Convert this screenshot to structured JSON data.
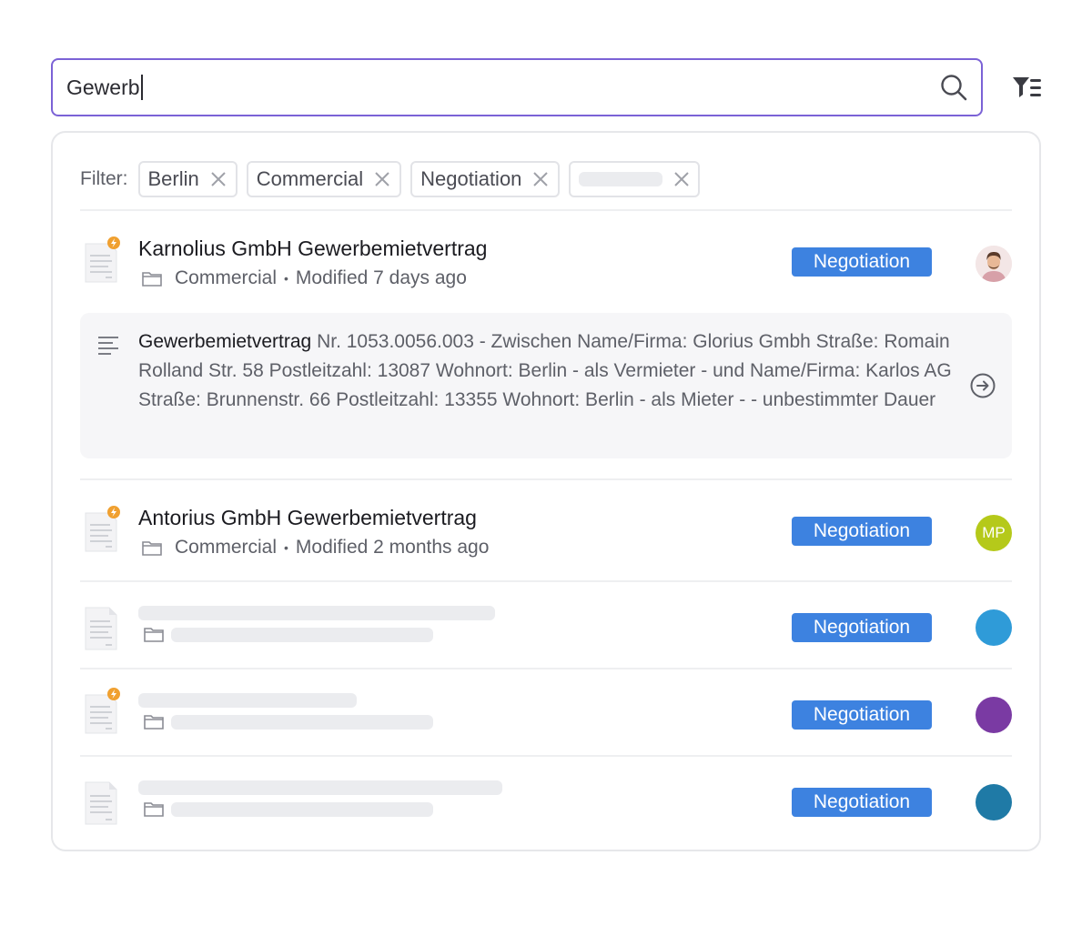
{
  "search": {
    "value": "Gewerb"
  },
  "filters": {
    "label": "Filter:",
    "chips": [
      "Berlin",
      "Commercial",
      "Negotiation"
    ]
  },
  "results": [
    {
      "title": "Karnolius GmbH Gewerbemietvertrag",
      "category": "Commercial",
      "separator": "•",
      "modified": "Modified 7 days ago",
      "status": "Negotiation",
      "avatar": "",
      "flagged": true
    },
    {
      "title": "Antorius GmbH Gewerbemietvertrag",
      "category": "Commercial",
      "separator": "•",
      "modified": "Modified 2 months ago",
      "status": "Negotiation",
      "avatar": "MP",
      "flagged": true
    },
    {
      "status": "Negotiation",
      "flagged": false
    },
    {
      "status": "Negotiation",
      "flagged": true
    },
    {
      "status": "Negotiation",
      "flagged": false
    }
  ],
  "snippet": {
    "highlight": "Gewerbemietvertrag",
    "text": " Nr. 1053.0056.003 - Zwischen Name/Firma: Glorius Gmbh Straße: Romain Rolland Str. 58 Postleitzahl: 13087 Wohnort: Berlin - als Vermieter - und Name/Firma: Karlos AG Straße: Brunnenstr. 66 Postleitzahl: 13355 Wohnort: Berlin - als Mieter - - unbestimmter Dauer"
  },
  "colors": {
    "accent": "#7b62d6",
    "status_badge": "#3d82e0",
    "flag": "#f0a030",
    "avatar_mp": "#b5c91a",
    "avatar_3": "#2f9bd8",
    "avatar_4": "#7a3aa3",
    "avatar_5": "#1f7aa6"
  }
}
